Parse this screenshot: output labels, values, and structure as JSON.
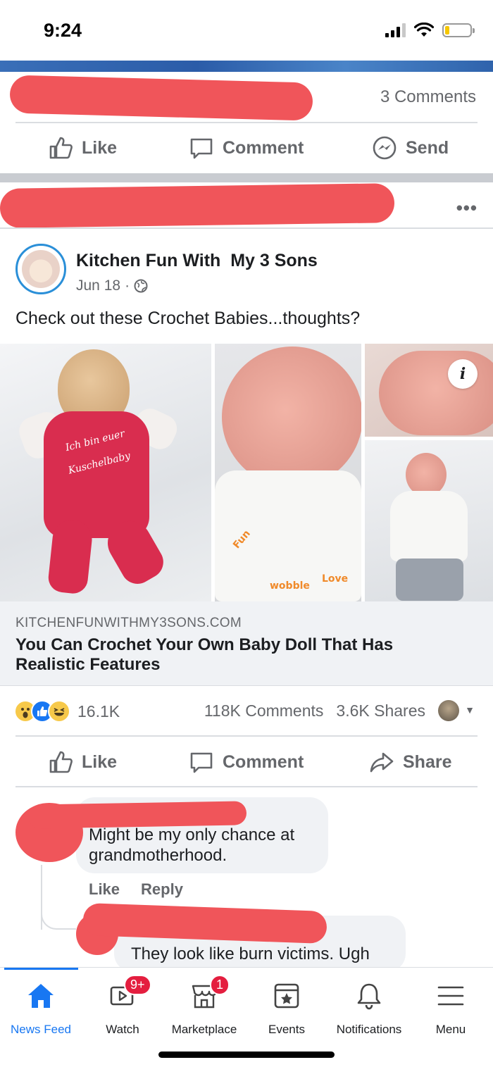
{
  "status_bar": {
    "time": "9:24"
  },
  "previous_post": {
    "comments_count": "3 Comments",
    "actions": {
      "like": "Like",
      "comment": "Comment",
      "send": "Send"
    }
  },
  "post": {
    "more": "•••",
    "page_name": "Kitchen Fun With  My 3 Sons",
    "date": "Jun 18",
    "date_separator": "·",
    "text": "Check out these Crochet Babies...thoughts?",
    "photos": {
      "info_icon_label": "i",
      "doll1_text_line1": "Ich bin euer",
      "doll1_text_line2": "Kuschelbaby",
      "shirt_print_1": "Fun",
      "shirt_print_2": "wobble",
      "shirt_print_3": "Love"
    },
    "link": {
      "domain": "KITCHENFUNWITHMY3SONS.COM",
      "title": "You Can Crochet Your Own Baby Doll That Has Realistic Features"
    },
    "reactions": {
      "count": "16.1K",
      "types": [
        "wow",
        "like",
        "haha"
      ]
    },
    "engagement": {
      "comments": "118K Comments",
      "shares": "3.6K Shares"
    },
    "actions": {
      "like": "Like",
      "comment": "Comment",
      "share": "Share"
    }
  },
  "comments": [
    {
      "text": "Might be my only chance at grandmotherhood.",
      "actions": {
        "like": "Like",
        "reply": "Reply"
      }
    },
    {
      "text": "They look like burn victims. Ugh"
    }
  ],
  "tab_bar": {
    "tabs": [
      {
        "label": "News Feed",
        "icon": "home-icon",
        "active": true
      },
      {
        "label": "Watch",
        "icon": "watch-icon",
        "badge": "9+"
      },
      {
        "label": "Marketplace",
        "icon": "marketplace-icon",
        "badge": "1"
      },
      {
        "label": "Events",
        "icon": "events-icon"
      },
      {
        "label": "Notifications",
        "icon": "bell-icon"
      },
      {
        "label": "Menu",
        "icon": "menu-icon"
      }
    ]
  },
  "colors": {
    "facebook_blue": "#1877f2",
    "redaction": "#f0555a",
    "secondary_text": "#65676b",
    "badge_red": "#e41e3f"
  }
}
